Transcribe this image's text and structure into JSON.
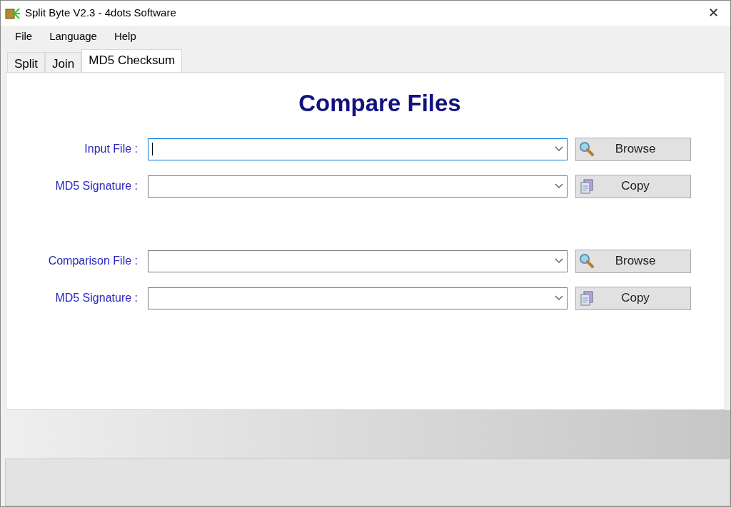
{
  "window": {
    "title": "Split Byte V2.3 - 4dots Software",
    "close": "✕"
  },
  "menu": [
    "File",
    "Language",
    "Help"
  ],
  "tabs": [
    {
      "label": "Split",
      "selected": false
    },
    {
      "label": "Join",
      "selected": false
    },
    {
      "label": "MD5 Checksum",
      "selected": true
    }
  ],
  "heading": "Compare Files",
  "groups": [
    [
      {
        "label": "Input File :",
        "focused": true,
        "button": {
          "label": "Browse",
          "kind": "browse"
        }
      },
      {
        "label": "MD5 Signature :",
        "focused": false,
        "button": {
          "label": "Copy",
          "kind": "copy"
        }
      }
    ],
    [
      {
        "label": "Comparison File :",
        "focused": false,
        "button": {
          "label": "Browse",
          "kind": "browse"
        }
      },
      {
        "label": "MD5 Signature :",
        "focused": false,
        "button": {
          "label": "Copy",
          "kind": "copy"
        }
      }
    ]
  ]
}
